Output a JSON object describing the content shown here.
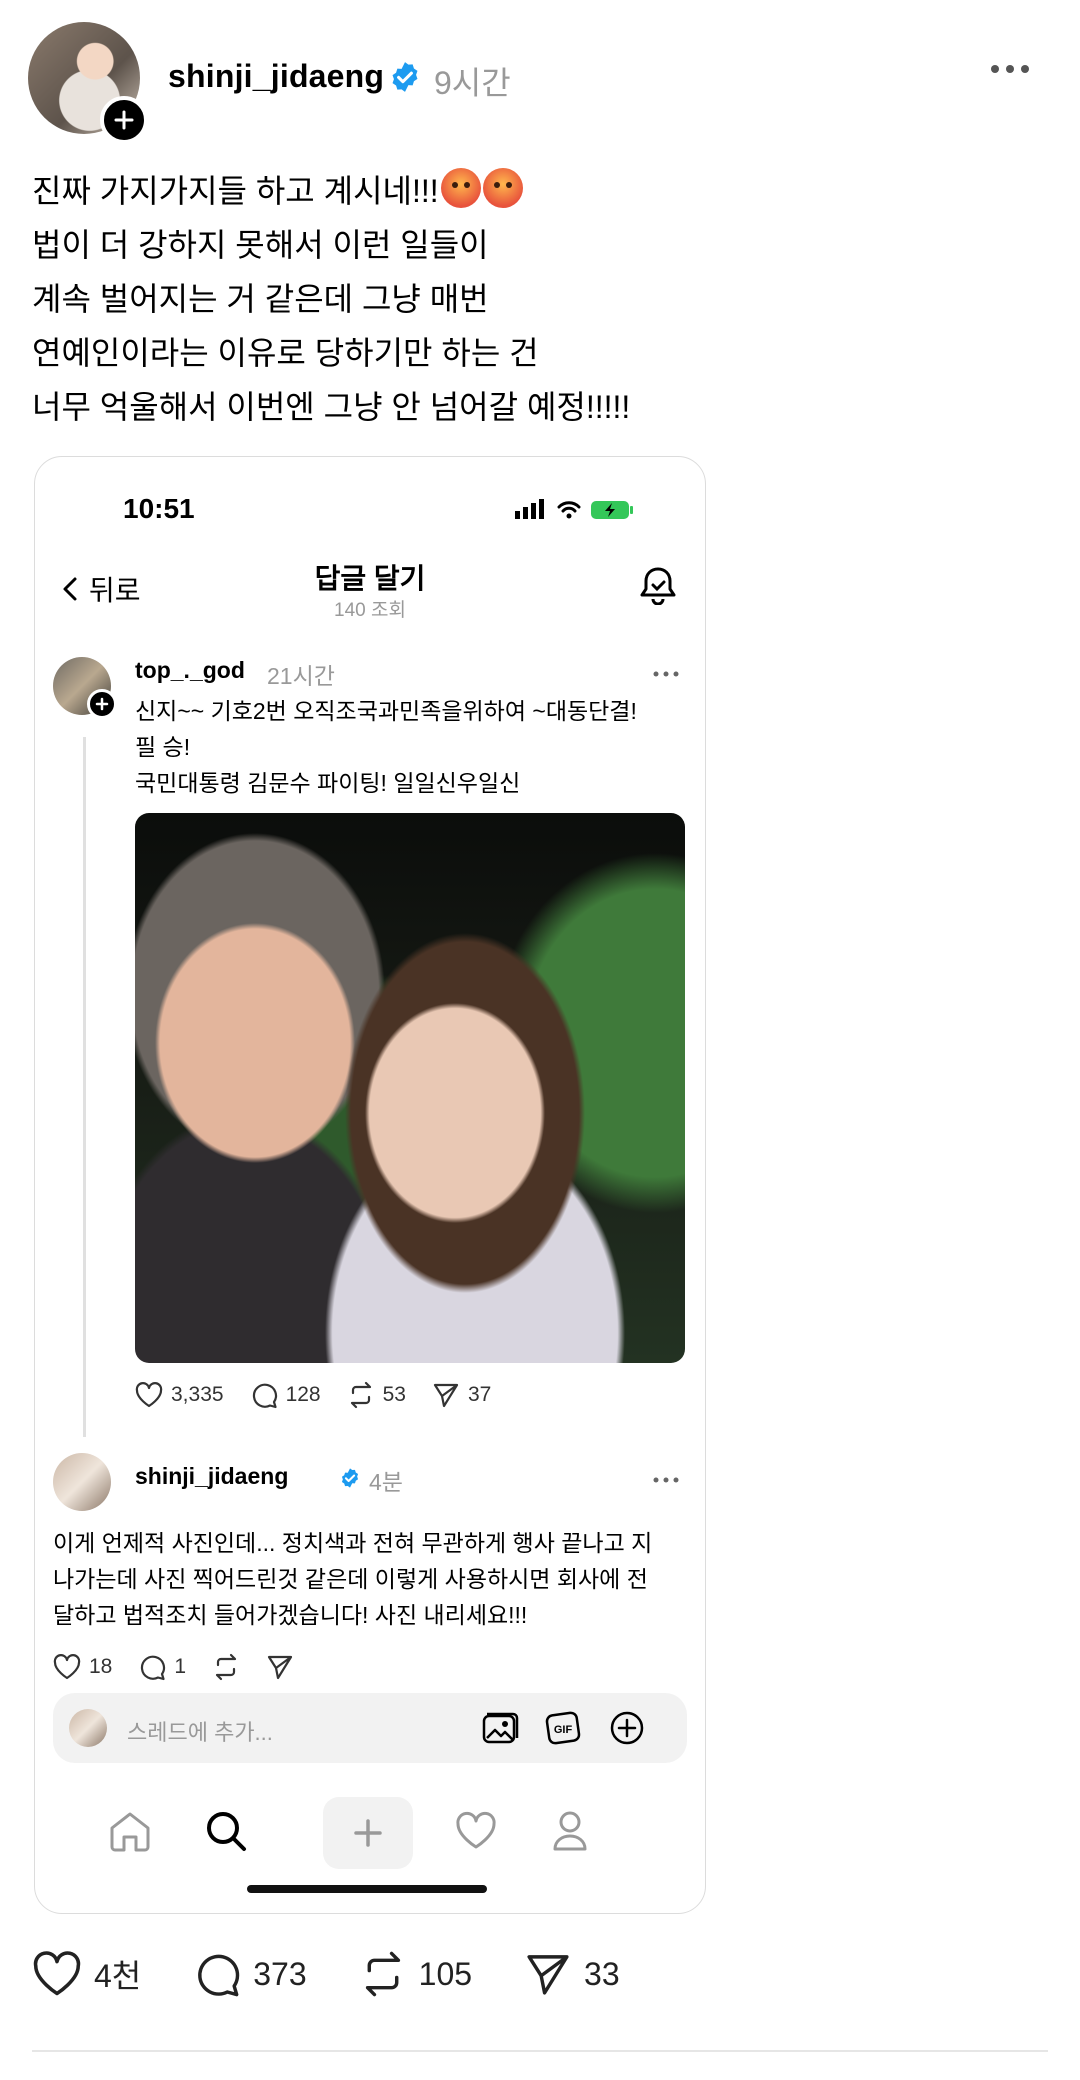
{
  "post": {
    "username": "shinji_jidaeng",
    "time": "9시간",
    "lines": [
      "진짜 가지가지들 하고 계시네!!!",
      "법이 더 강하지 못해서 이런 일들이",
      "계속 벌어지는 거 같은데 그냥 매번",
      "연예인이라는 이유로 당하기만 하는 건",
      "너무 억울해서 이번엔 그냥 안 넘어갈 예정!!!!!"
    ],
    "likes": "4천",
    "comments": "373",
    "reposts": "105",
    "shares": "33"
  },
  "screenshot": {
    "status_time": "10:51",
    "back_label": "뒤로",
    "title": "답글 달기",
    "views": "140 조회",
    "comment": {
      "username": "top_._god",
      "time": "21시간",
      "lines": [
        "신지~~ 기호2번  오직조국과민족을위하여 ~대동단결!",
        "필 승!",
        "국민대통령 김문수 파이팅! 일일신우일신"
      ],
      "likes": "3,335",
      "comments": "128",
      "reposts": "53",
      "shares": "37"
    },
    "reply": {
      "username": "shinji_jidaeng",
      "time": "4분",
      "lines": [
        "이게 언제적 사진인데... 정치색과 전혀 무관하게 행사 끝나고 지",
        "나가는데 사진 찍어드린것 같은데 이렇게 사용하시면 회사에 전",
        "달하고 법적조치 들어가겠습니다! 사진 내리세요!!!"
      ],
      "likes": "18",
      "comments": "1"
    },
    "compose_placeholder": "스레드에 추가...",
    "gif_label": "GIF"
  },
  "colors": {
    "verified": "#1d9bf0",
    "muted": "#999999",
    "text": "#000000"
  },
  "icons": [
    "plus-icon",
    "verified-icon",
    "more-icon",
    "heart-icon",
    "comment-icon",
    "repost-icon",
    "send-icon",
    "bell-icon",
    "home-icon",
    "search-icon",
    "image-icon",
    "gif-icon",
    "profile-icon",
    "back-icon"
  ]
}
